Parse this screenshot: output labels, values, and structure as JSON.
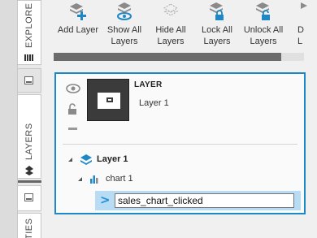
{
  "side_tabs": {
    "explore_label": "EXPLORE",
    "layers_label": "LAYERS",
    "properties_label": "TIES"
  },
  "toolbar": {
    "add_layer": "Add Layer",
    "show_all_layers": "Show All\nLayers",
    "hide_all_layers": "Hide All\nLayers",
    "lock_all_layers": "Lock All\nLayers",
    "unlock_all_layers": "Unlock All\nLayers",
    "overflow": "D\nL"
  },
  "scrollbar": {
    "thumb_fraction": 0.91
  },
  "layer_panel": {
    "heading": "LAYER",
    "layer_name": "Layer 1",
    "tree": {
      "layer_label": "Layer 1",
      "chart_label": "chart 1"
    },
    "rename_value": "sales_chart_clicked"
  },
  "colors": {
    "accent": "#1e88c7",
    "selection": "#b7dcf3",
    "icon_gray": "#8a8a8a"
  },
  "icons": [
    "add-layer-icon",
    "show-icon",
    "hide-icon",
    "lock-icon",
    "unlock-icon",
    "eye-icon",
    "layer-stack-icon",
    "chart-icon"
  ]
}
